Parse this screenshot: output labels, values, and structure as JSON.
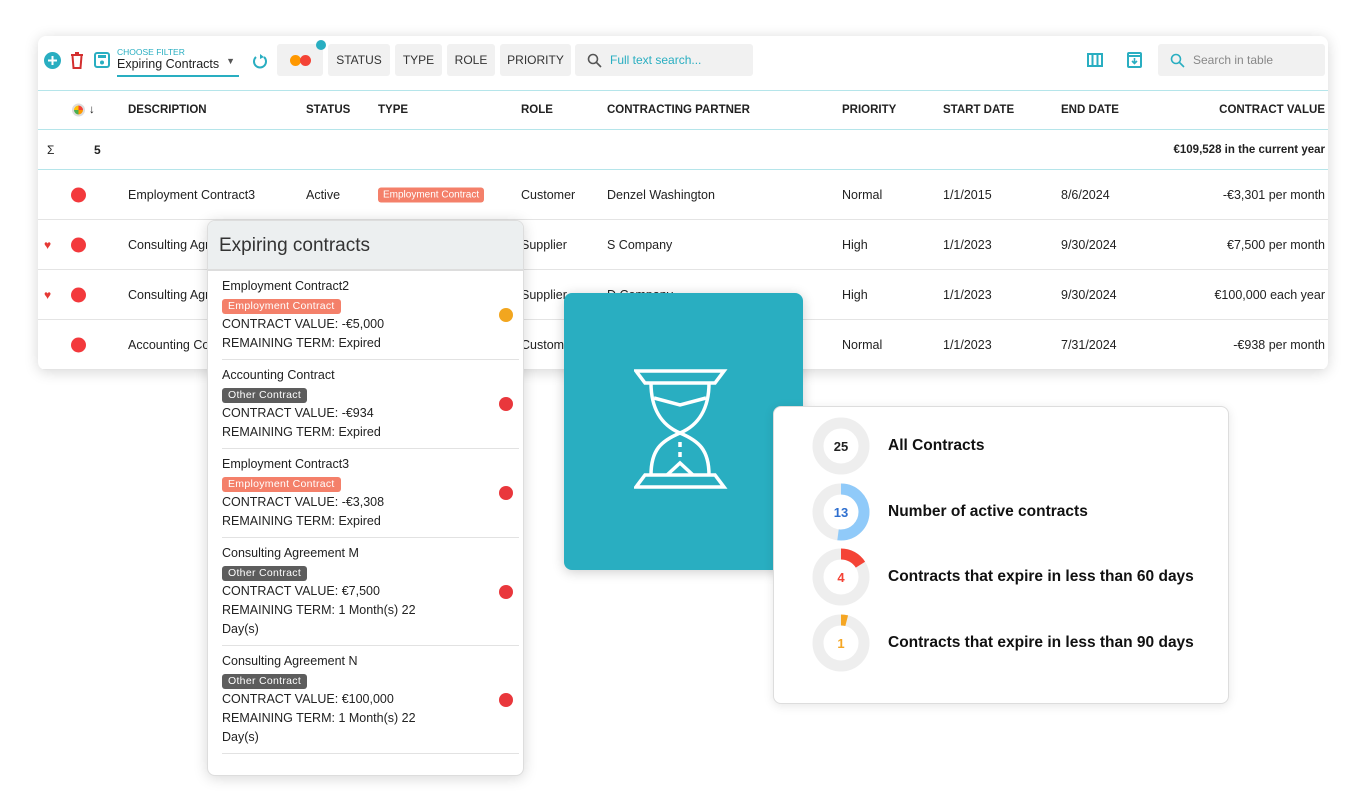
{
  "toolbar": {
    "filter_label": "CHOOSE FILTER",
    "filter_value": "Expiring Contracts",
    "chips": [
      "STATUS",
      "TYPE",
      "ROLE",
      "PRIORITY"
    ],
    "fulltext_placeholder": "Full text search...",
    "table_search_placeholder": "Search in table",
    "accent": "#29aec1"
  },
  "table": {
    "columns": [
      "DESCRIPTION",
      "STATUS",
      "TYPE",
      "ROLE",
      "CONTRACTING PARTNER",
      "PRIORITY",
      "START DATE",
      "END DATE",
      "CONTRACT VALUE"
    ],
    "sum": {
      "symbol": "Σ",
      "count": "5",
      "total": "€109,528 in the current year"
    },
    "rows": [
      {
        "fav": false,
        "description": "Employment Contract3",
        "status": "Active",
        "type": "Employment Contract",
        "role": "Customer",
        "partner": "Denzel Washington",
        "priority": "Normal",
        "start": "1/1/2015",
        "end": "8/6/2024",
        "value": "-€3,301 per month"
      },
      {
        "fav": true,
        "description": "Consulting Agreement M",
        "status": "",
        "type": "",
        "role": "Supplier",
        "partner": "S Company",
        "priority": "High",
        "start": "1/1/2023",
        "end": "9/30/2024",
        "value": "€7,500 per month"
      },
      {
        "fav": true,
        "description": "Consulting Agreement N",
        "status": "",
        "type": "",
        "role": "Supplier",
        "partner": "D Company",
        "priority": "High",
        "start": "1/1/2023",
        "end": "9/30/2024",
        "value": "€100,000 each year"
      },
      {
        "fav": false,
        "description": "Accounting Contract",
        "status": "",
        "type": "",
        "role": "Customer",
        "partner": "",
        "priority": "Normal",
        "start": "1/1/2023",
        "end": "7/31/2024",
        "value": "-€938 per month"
      }
    ]
  },
  "popup": {
    "title": "Expiring contracts",
    "items": [
      {
        "name": "Employment Contract2",
        "type": "Employment Contract",
        "type_color": "#f4806a",
        "value": "CONTRACT VALUE: -€5,000",
        "term": "REMAINING TERM: Expired",
        "dot": "#f2a61f"
      },
      {
        "name": "Accounting Contract",
        "type": "Other Contract",
        "type_color": "#5d5d5d",
        "value": "CONTRACT VALUE: -€934",
        "term": "REMAINING TERM: Expired",
        "dot": "#e9373c"
      },
      {
        "name": "Employment Contract3",
        "type": "Employment Contract",
        "type_color": "#f4806a",
        "value": "CONTRACT VALUE: -€3,308",
        "term": "REMAINING TERM: Expired",
        "dot": "#e9373c"
      },
      {
        "name": "Consulting Agreement M",
        "type": "Other Contract",
        "type_color": "#5d5d5d",
        "value": "CONTRACT VALUE: €7,500",
        "term": "REMAINING TERM: 1 Month(s) 22 Day(s)",
        "dot": "#e9373c"
      },
      {
        "name": "Consulting Agreement N",
        "type": "Other Contract",
        "type_color": "#5d5d5d",
        "value": "CONTRACT VALUE: €100,000",
        "term": "REMAINING TERM: 1 Month(s) 22 Day(s)",
        "dot": "#e9373c"
      }
    ]
  },
  "stats": {
    "total": 25,
    "items": [
      {
        "value": "25",
        "label": "All Contracts",
        "fraction": 0,
        "color": "#222222",
        "ring": "#eeeeee"
      },
      {
        "value": "13",
        "label": "Number of active contracts",
        "fraction": 0.52,
        "color": "#2e6fcf",
        "ring": "#90caf9"
      },
      {
        "value": "4",
        "label": "Contracts that expire in less than 60 days",
        "fraction": 0.16,
        "color": "#f44336",
        "ring": "#f44336"
      },
      {
        "value": "1",
        "label": "Contracts that expire in less than 90 days",
        "fraction": 0.04,
        "color": "#f5a623",
        "ring": "#f5a623"
      }
    ]
  }
}
